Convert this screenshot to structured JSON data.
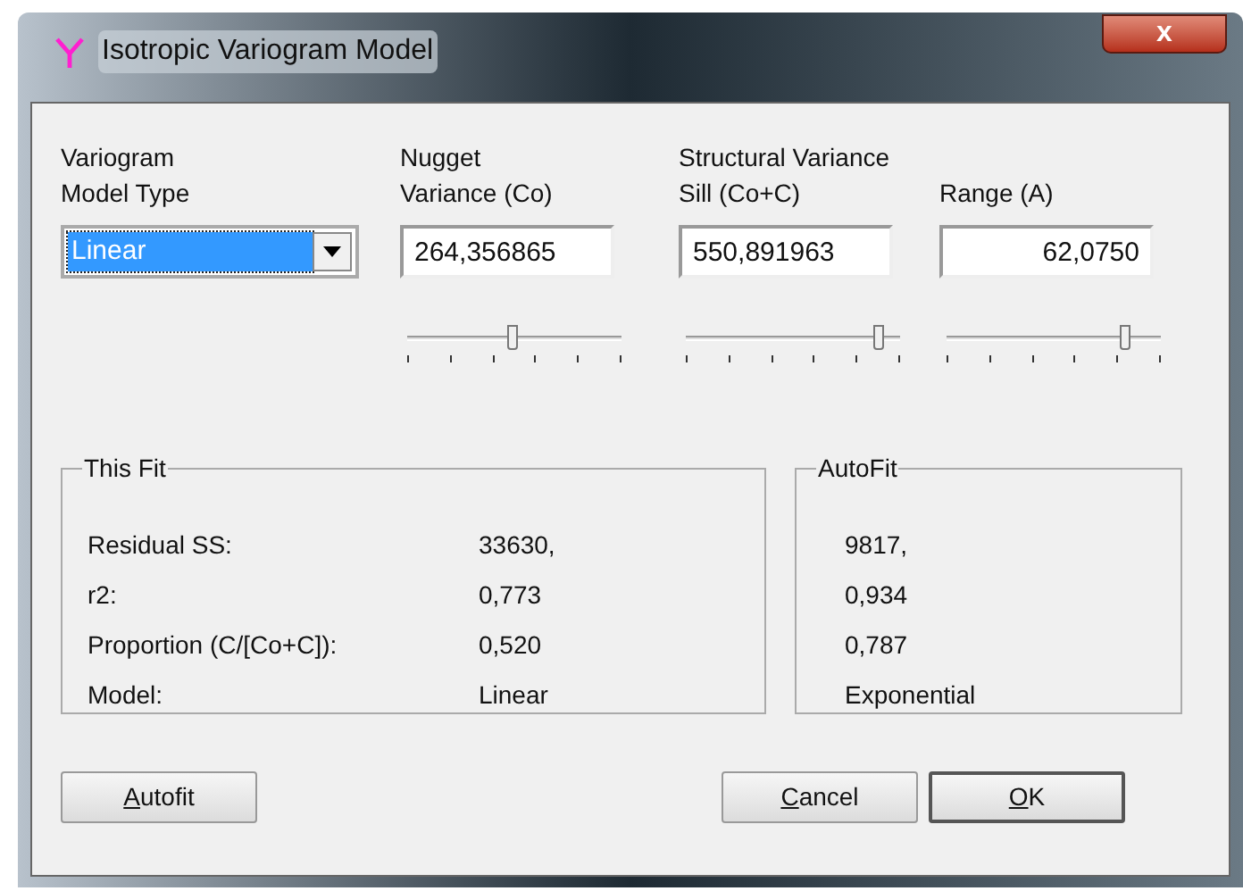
{
  "window": {
    "title": "Isotropic Variogram Model",
    "close": "x"
  },
  "columns": [
    {
      "kind": "combo",
      "label": "Variogram\nModel Type",
      "value": "Linear"
    },
    {
      "kind": "slider",
      "label": "Nugget\nVariance (Co)",
      "value": "264,356865",
      "level": 0.49
    },
    {
      "kind": "slider",
      "group": "Structural Variance",
      "label": "Sill (Co+C)",
      "value": "550,891963",
      "level": 0.9
    },
    {
      "kind": "slider",
      "label": "Range (A)",
      "value": "62,0750",
      "level": 0.83
    }
  ],
  "this_fit": {
    "title": "This Fit",
    "rows": [
      {
        "label": "Residual SS:",
        "value": "33630,"
      },
      {
        "label": "r2:",
        "value": "0,773"
      },
      {
        "label": "Proportion (C/[Co+C]):",
        "value": "0,520"
      },
      {
        "label": "Model:",
        "value": "Linear"
      }
    ]
  },
  "autofit": {
    "title": "AutoFit",
    "values": [
      "9817,",
      "0,934",
      "0,787",
      "Exponential"
    ]
  },
  "buttons": [
    {
      "label": "Autofit",
      "underline_first": true,
      "default": false
    },
    {
      "label": "Cancel",
      "underline_first": true,
      "default": false
    },
    {
      "label": "OK",
      "underline_first": true,
      "default": true
    }
  ]
}
